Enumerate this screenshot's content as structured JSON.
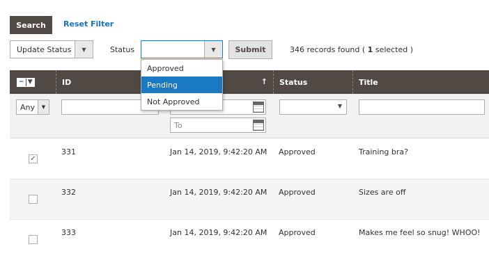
{
  "toolbar": {
    "search_label": "Search",
    "reset_label": "Reset Filter",
    "update_status_label": "Update Status",
    "status_label": "Status",
    "status_value": "",
    "submit_label": "Submit",
    "records_prefix": "346 records found ( ",
    "records_selected_count": "1",
    "records_suffix": " selected )"
  },
  "status_dropdown": {
    "options": [
      "Approved",
      "Pending",
      "Not Approved"
    ],
    "highlighted": "Pending"
  },
  "columns": {
    "id": "ID",
    "status": "Status",
    "title": "Title",
    "sort_icon": "arrow-up-icon"
  },
  "filters": {
    "any_label": "Any",
    "date_to_placeholder": "To"
  },
  "rows": [
    {
      "checked": true,
      "id": "331",
      "date": "Jan 14, 2019, 9:42:20 AM",
      "status": "Approved",
      "title": "Training bra?"
    },
    {
      "checked": false,
      "id": "332",
      "date": "Jan 14, 2019, 9:42:20 AM",
      "status": "Approved",
      "title": "Sizes are off"
    },
    {
      "checked": false,
      "id": "333",
      "date": "Jan 14, 2019, 9:42:20 AM",
      "status": "Approved",
      "title": "Makes me feel so snug! WHOO!"
    }
  ],
  "colors": {
    "header_bg": "#514943",
    "accent": "#1979c3",
    "link": "#1c6fb4"
  }
}
